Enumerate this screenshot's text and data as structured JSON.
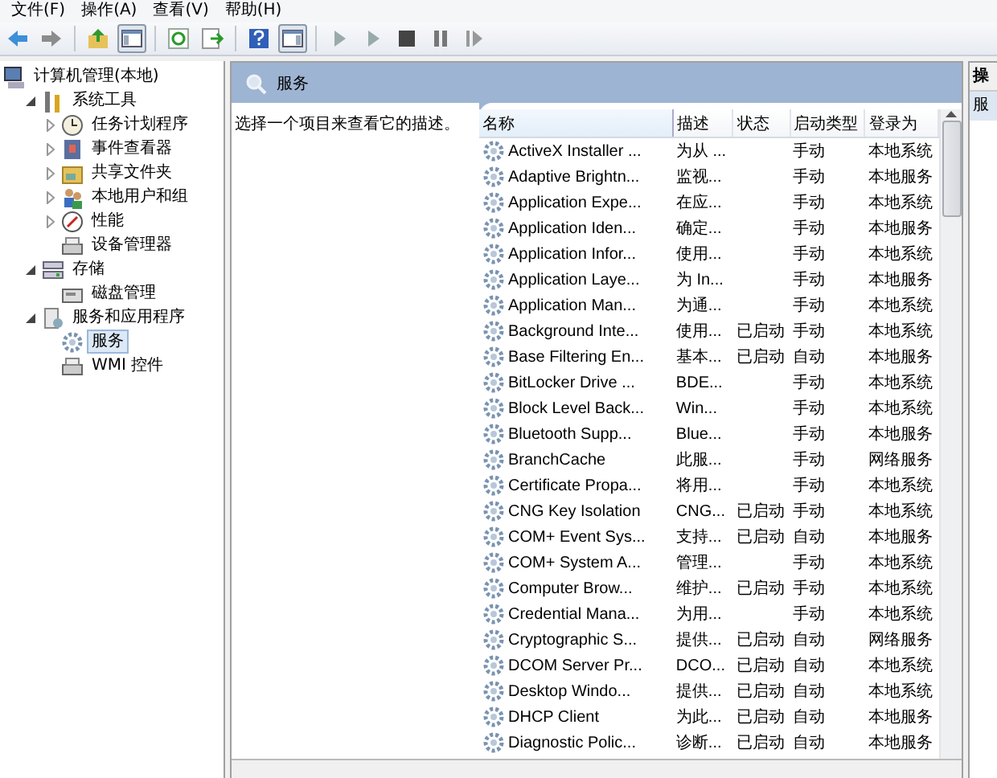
{
  "menu": [
    "文件(F)",
    "操作(A)",
    "查看(V)",
    "帮助(H)"
  ],
  "tree": [
    {
      "label": "计算机管理(本地)",
      "selected": false,
      "children": [
        {
          "label": "系统工具",
          "expanded": true,
          "selected": false,
          "children": [
            {
              "label": "任务计划程序",
              "expanded": false,
              "selected": false
            },
            {
              "label": "事件查看器",
              "expanded": false,
              "selected": false
            },
            {
              "label": "共享文件夹",
              "expanded": false,
              "selected": false
            },
            {
              "label": "本地用户和组",
              "expanded": false,
              "selected": false
            },
            {
              "label": "性能",
              "expanded": false,
              "selected": false
            },
            {
              "label": "设备管理器",
              "selected": false
            }
          ]
        },
        {
          "label": "存储",
          "expanded": true,
          "selected": false,
          "children": [
            {
              "label": "磁盘管理",
              "selected": false
            }
          ]
        },
        {
          "label": "服务和应用程序",
          "expanded": true,
          "selected": false,
          "children": [
            {
              "label": "服务",
              "selected": true
            },
            {
              "label": "WMI 控件",
              "selected": false
            }
          ]
        }
      ]
    }
  ],
  "panel": {
    "title": "服务",
    "description": "选择一个项目来查看它的描述。"
  },
  "columns": [
    "名称",
    "描述",
    "状态",
    "启动类型",
    "登录为"
  ],
  "rows": [
    [
      "ActiveX Installer ...",
      "为从 ...",
      "",
      "手动",
      "本地系统"
    ],
    [
      "Adaptive Brightn...",
      "监视...",
      "",
      "手动",
      "本地服务"
    ],
    [
      "Application Expe...",
      "在应...",
      "",
      "手动",
      "本地系统"
    ],
    [
      "Application Iden...",
      "确定...",
      "",
      "手动",
      "本地服务"
    ],
    [
      "Application Infor...",
      "使用...",
      "",
      "手动",
      "本地系统"
    ],
    [
      "Application Laye...",
      "为 In...",
      "",
      "手动",
      "本地服务"
    ],
    [
      "Application Man...",
      "为通...",
      "",
      "手动",
      "本地系统"
    ],
    [
      "Background Inte...",
      "使用...",
      "已启动",
      "手动",
      "本地系统"
    ],
    [
      "Base Filtering En...",
      "基本...",
      "已启动",
      "自动",
      "本地服务"
    ],
    [
      "BitLocker Drive ...",
      "BDE...",
      "",
      "手动",
      "本地系统"
    ],
    [
      "Block Level Back...",
      "Win...",
      "",
      "手动",
      "本地系统"
    ],
    [
      "Bluetooth Supp...",
      "Blue...",
      "",
      "手动",
      "本地服务"
    ],
    [
      "BranchCache",
      "此服...",
      "",
      "手动",
      "网络服务"
    ],
    [
      "Certificate Propa...",
      "将用...",
      "",
      "手动",
      "本地系统"
    ],
    [
      "CNG Key Isolation",
      "CNG...",
      "已启动",
      "手动",
      "本地系统"
    ],
    [
      "COM+ Event Sys...",
      "支持...",
      "已启动",
      "自动",
      "本地服务"
    ],
    [
      "COM+ System A...",
      "管理...",
      "",
      "手动",
      "本地系统"
    ],
    [
      "Computer Brow...",
      "维护...",
      "已启动",
      "手动",
      "本地系统"
    ],
    [
      "Credential Mana...",
      "为用...",
      "",
      "手动",
      "本地系统"
    ],
    [
      "Cryptographic S...",
      "提供...",
      "已启动",
      "自动",
      "网络服务"
    ],
    [
      "DCOM Server Pr...",
      "DCO...",
      "已启动",
      "自动",
      "本地系统"
    ],
    [
      "Desktop Windo...",
      "提供...",
      "已启动",
      "自动",
      "本地系统"
    ],
    [
      "DHCP Client",
      "为此...",
      "已启动",
      "自动",
      "本地服务"
    ],
    [
      "Diagnostic Polic...",
      "诊断...",
      "已启动",
      "自动",
      "本地服务"
    ]
  ],
  "actions": {
    "title": "操",
    "item": "服"
  }
}
